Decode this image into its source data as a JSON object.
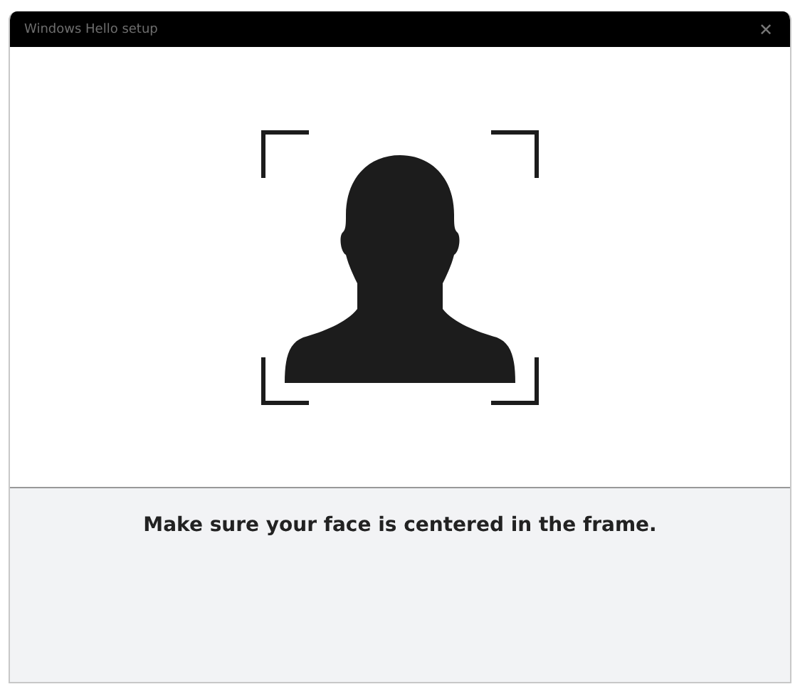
{
  "window": {
    "title": "Windows Hello setup",
    "close": "✕"
  },
  "instruction": "Make sure your face is centered in the frame."
}
